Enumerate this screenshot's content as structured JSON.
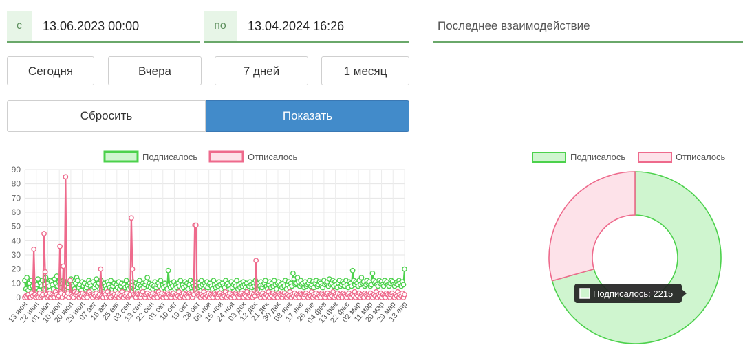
{
  "filters": {
    "from_prefix": "с",
    "from_value": "13.06.2023 00:00",
    "to_prefix": "по",
    "to_value": "13.04.2024 16:26",
    "last_interaction_placeholder": "Последнее взаимодействие"
  },
  "presets": [
    "Сегодня",
    "Вчера",
    "7 дней",
    "1 месяц"
  ],
  "actions": {
    "reset_label": "Сбросить",
    "show_label": "Показать"
  },
  "colors": {
    "subscribed_line": "#4cd14c",
    "subscribed_fill": "#cff5cf",
    "unsubscribed_line": "#ee6a8c",
    "unsubscribed_fill": "#fde2e9",
    "primary_button": "#428bca",
    "accent_green": "#6aa86a"
  },
  "chart_data": [
    {
      "type": "line",
      "legend": [
        "Подписалось",
        "Отписалось"
      ],
      "legend_position": "top",
      "grid": true,
      "ylim": [
        0,
        90
      ],
      "yticks": [
        0,
        10,
        20,
        30,
        40,
        50,
        60,
        70,
        80,
        90
      ],
      "xtick_labels": [
        "13 июн",
        "22 июн",
        "01 июл",
        "10 июл",
        "20 июл",
        "29 июл",
        "07 авг",
        "16 авг",
        "25 авг",
        "03 сен",
        "13 сен",
        "22 сен",
        "01 окт",
        "10 окт",
        "19 окт",
        "28 окт",
        "06 ноя",
        "15 ноя",
        "24 ноя",
        "03 дек",
        "12 дек",
        "21 дек",
        "30 дек",
        "08 янв",
        "17 янв",
        "26 янв",
        "04 фев",
        "13 фев",
        "22 фев",
        "02 мар",
        "11 мар",
        "20 мар",
        "29 мар",
        "13 апр"
      ],
      "series": [
        {
          "name": "Подписалось",
          "values": [
            12,
            6,
            14,
            5,
            10,
            7,
            12,
            8,
            6,
            11,
            7,
            9,
            13,
            5,
            10,
            8,
            12,
            6,
            9,
            14,
            7,
            10,
            8,
            12,
            11,
            9,
            6,
            13,
            10,
            15,
            8,
            11,
            9,
            7,
            10,
            12,
            6,
            9,
            8,
            10,
            7,
            11,
            13,
            9,
            8,
            6,
            10,
            14,
            12,
            7,
            9,
            5,
            11,
            8,
            10,
            6,
            7,
            9,
            12,
            10,
            8,
            6,
            11,
            7,
            9,
            13,
            8,
            10,
            6,
            12,
            9,
            7,
            10,
            8,
            6,
            11,
            9,
            7,
            12,
            6,
            8,
            10,
            5,
            9,
            7,
            11,
            6,
            8,
            10,
            5,
            9,
            7,
            12,
            8,
            6,
            10,
            7,
            9,
            11,
            6,
            8,
            10,
            7,
            9,
            12,
            8,
            6,
            10,
            7,
            9,
            11,
            14,
            8,
            10,
            7,
            9,
            6,
            8,
            11,
            7,
            9,
            10,
            8,
            12,
            6,
            9,
            7,
            10,
            8,
            6,
            19,
            9,
            7,
            10,
            8,
            11,
            6,
            9,
            7,
            10,
            8,
            12,
            6,
            9,
            7,
            11,
            8,
            10,
            6,
            9,
            12,
            7,
            10,
            8,
            6,
            9,
            11,
            7,
            10,
            8,
            12,
            9,
            6,
            10,
            8,
            11,
            7,
            9,
            10,
            8,
            6,
            12,
            9,
            7,
            10,
            8,
            11,
            9,
            6,
            10,
            8,
            7,
            12,
            9,
            10,
            8,
            6,
            11,
            7,
            9,
            10,
            8,
            12,
            6,
            9,
            7,
            10,
            8,
            11,
            9,
            7,
            10,
            6,
            8,
            11,
            9,
            7,
            10,
            8,
            12,
            9,
            6,
            10,
            8,
            11,
            7,
            9,
            10,
            12,
            8,
            6,
            9,
            11,
            7,
            10,
            8,
            12,
            9,
            6,
            10,
            11,
            8,
            9,
            7,
            10,
            8,
            12,
            6,
            9,
            11,
            7,
            10,
            8,
            17,
            13,
            9,
            10,
            14,
            11,
            8,
            12,
            9,
            10,
            7,
            11,
            8,
            9,
            10,
            12,
            8,
            9,
            11,
            7,
            10,
            12,
            8,
            9,
            11,
            10,
            8,
            7,
            12,
            9,
            10,
            11,
            8,
            13,
            9,
            10,
            12,
            8,
            11,
            9,
            7,
            10,
            12,
            8,
            9,
            11,
            10,
            8,
            12,
            9,
            7,
            11,
            10,
            8,
            19,
            12,
            9,
            11,
            10,
            8,
            12,
            9,
            14,
            10,
            11,
            8,
            9,
            12,
            10,
            11,
            8,
            9,
            17,
            12,
            10,
            11,
            9,
            8,
            12,
            10,
            11,
            9,
            8,
            12,
            10,
            11,
            9,
            8,
            10,
            12,
            11,
            9,
            8,
            10,
            11,
            9,
            12,
            10,
            8,
            11,
            9,
            20
          ]
        },
        {
          "name": "Отписалось",
          "values": [
            0,
            1,
            0,
            2,
            0,
            0,
            3,
            1,
            34,
            2,
            0,
            1,
            0,
            3,
            0,
            1,
            2,
            45,
            18,
            2,
            0,
            1,
            3,
            0,
            2,
            1,
            0,
            4,
            2,
            0,
            1,
            36,
            3,
            0,
            22,
            2,
            85,
            1,
            3,
            0,
            12,
            2,
            1,
            0,
            4,
            2,
            3,
            1,
            0,
            2,
            1,
            3,
            0,
            2,
            1,
            0,
            3,
            4,
            2,
            1,
            0,
            2,
            1,
            3,
            0,
            1,
            2,
            20,
            1,
            0,
            3,
            2,
            0,
            4,
            1,
            2,
            0,
            3,
            1,
            2,
            0,
            1,
            3,
            0,
            2,
            1,
            4,
            0,
            2,
            1,
            3,
            0,
            1,
            2,
            56,
            20,
            2,
            1,
            0,
            3,
            2,
            1,
            0,
            2,
            4,
            1,
            0,
            2,
            3,
            1,
            0,
            2,
            1,
            3,
            0,
            2,
            1,
            0,
            4,
            2,
            1,
            3,
            0,
            2,
            1,
            0,
            3,
            2,
            1,
            0,
            2,
            3,
            1,
            0,
            2,
            1,
            4,
            0,
            2,
            1,
            3,
            0,
            2,
            1,
            0,
            3,
            2,
            1,
            0,
            2,
            51,
            51,
            3,
            2,
            1,
            0,
            2,
            1,
            4,
            0,
            2,
            1,
            3,
            0,
            2,
            1,
            0,
            3,
            2,
            1,
            0,
            2,
            3,
            1,
            0,
            2,
            1,
            4,
            0,
            2,
            1,
            3,
            0,
            2,
            1,
            0,
            3,
            2,
            1,
            0,
            2,
            3,
            1,
            0,
            2,
            1,
            4,
            0,
            2,
            1,
            3,
            0,
            2,
            1,
            26,
            3,
            2,
            1,
            0,
            2,
            3,
            1,
            0,
            2,
            1,
            4,
            0,
            2,
            1,
            3,
            0,
            2,
            1,
            0,
            3,
            2,
            1,
            0,
            2,
            3,
            1,
            0,
            2,
            1,
            4,
            0,
            2,
            1,
            3,
            0,
            2,
            1,
            0,
            3,
            2,
            1,
            0,
            2,
            3,
            1,
            0,
            2,
            1,
            4,
            0,
            2,
            1,
            3,
            0,
            2,
            1,
            0,
            3,
            2,
            1,
            0,
            2,
            3,
            1,
            0,
            2,
            1,
            4,
            0,
            2,
            1,
            3,
            0,
            2,
            1,
            0,
            3,
            2,
            1,
            0,
            2,
            3,
            1,
            0,
            2,
            1,
            4,
            0,
            2,
            1,
            3,
            0,
            2,
            1,
            0,
            3,
            2,
            1,
            0,
            2,
            3,
            1,
            0,
            2,
            1,
            4,
            0,
            2,
            1,
            3,
            0,
            2,
            1,
            0,
            3,
            2,
            1,
            0,
            2,
            3,
            1,
            0,
            2,
            1,
            4,
            0,
            2,
            1,
            3,
            0,
            2
          ]
        }
      ]
    },
    {
      "type": "pie",
      "variant": "doughnut",
      "legend": [
        "Подписалось",
        "Отписалось"
      ],
      "legend_position": "top",
      "categories": [
        "Подписалось",
        "Отписалось"
      ],
      "values": [
        2215,
        920
      ],
      "tooltip": {
        "label": "Подписалось",
        "value": "2215",
        "text": "Подписалось: 2215"
      }
    }
  ]
}
